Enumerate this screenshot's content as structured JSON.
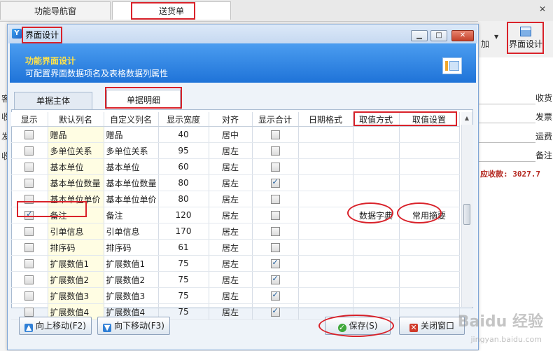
{
  "app": {
    "tabs": [
      {
        "label": "功能导航窗"
      },
      {
        "label": "送货单"
      }
    ],
    "close_glyph": "✕",
    "toolbar": {
      "small_label": "加",
      "design_label": "界面设计"
    },
    "form_labels": [
      "收货",
      "发票",
      "运费",
      "备注"
    ],
    "left_labels": [
      "客",
      "收",
      "发",
      "收"
    ],
    "total_text": "应收款: 3027.7"
  },
  "dialog": {
    "title": "界面设计",
    "banner": {
      "heading": "功能界面设计",
      "subtitle": "可配置界面数据项名及表格数据列属性"
    },
    "tabs": [
      {
        "label": "单据主体",
        "active": false
      },
      {
        "label": "单据明细",
        "active": true
      }
    ],
    "columns": [
      "显示",
      "默认列名",
      "自定义列名",
      "显示宽度",
      "对齐",
      "显示合计",
      "日期格式",
      "取值方式",
      "取值设置"
    ],
    "rows": [
      {
        "show": false,
        "default": "赠品",
        "custom": "赠品",
        "width": "40",
        "align": "居中",
        "sum": false,
        "date": "",
        "mode": "",
        "setting": ""
      },
      {
        "show": false,
        "default": "多单位关系",
        "custom": "多单位关系",
        "width": "95",
        "align": "居左",
        "sum": false,
        "date": "",
        "mode": "",
        "setting": ""
      },
      {
        "show": false,
        "default": "基本单位",
        "custom": "基本单位",
        "width": "60",
        "align": "居左",
        "sum": false,
        "date": "",
        "mode": "",
        "setting": ""
      },
      {
        "show": false,
        "default": "基本单位数量",
        "custom": "基本单位数量",
        "width": "80",
        "align": "居左",
        "sum": true,
        "date": "",
        "mode": "",
        "setting": ""
      },
      {
        "show": false,
        "default": "基本单位单价",
        "custom": "基本单位单价",
        "width": "80",
        "align": "居左",
        "sum": false,
        "date": "",
        "mode": "",
        "setting": ""
      },
      {
        "show": true,
        "default": "备注",
        "custom": "备注",
        "width": "120",
        "align": "居左",
        "sum": false,
        "date": "",
        "mode": "数据字典",
        "setting": "常用摘要"
      },
      {
        "show": false,
        "default": "引单信息",
        "custom": "引单信息",
        "width": "170",
        "align": "居左",
        "sum": false,
        "date": "",
        "mode": "",
        "setting": ""
      },
      {
        "show": false,
        "default": "排序码",
        "custom": "排序码",
        "width": "61",
        "align": "居左",
        "sum": false,
        "date": "",
        "mode": "",
        "setting": ""
      },
      {
        "show": false,
        "default": "扩展数值1",
        "custom": "扩展数值1",
        "width": "75",
        "align": "居左",
        "sum": true,
        "date": "",
        "mode": "",
        "setting": ""
      },
      {
        "show": false,
        "default": "扩展数值2",
        "custom": "扩展数值2",
        "width": "75",
        "align": "居左",
        "sum": true,
        "date": "",
        "mode": "",
        "setting": ""
      },
      {
        "show": false,
        "default": "扩展数值3",
        "custom": "扩展数值3",
        "width": "75",
        "align": "居左",
        "sum": true,
        "date": "",
        "mode": "",
        "setting": ""
      },
      {
        "show": false,
        "default": "扩展数值4",
        "custom": "扩展数值4",
        "width": "75",
        "align": "居左",
        "sum": true,
        "date": "",
        "mode": "",
        "setting": ""
      }
    ],
    "buttons": {
      "move_up": "向上移动(F2)",
      "move_down": "向下移动(F3)",
      "save": "保存(S)",
      "close": "关闭窗口"
    }
  },
  "watermark": {
    "brand": "Baidu 经验",
    "url": "jingyan.baidu.com"
  },
  "colors": {
    "banner_blue": "#1f73d8",
    "annotation_red": "#d9222a",
    "heading_yellow": "#ffe24a"
  }
}
